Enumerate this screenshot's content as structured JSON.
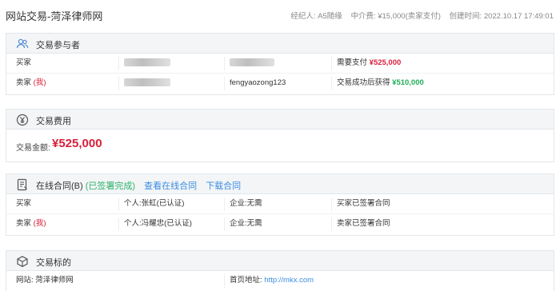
{
  "header": {
    "title": "网站交易-菏泽律师网",
    "broker": "经纪人: A5随缘",
    "fee": "中介费: ¥15,000(卖家支付)",
    "created": "创建时间: 2022.10.17 17:49:01"
  },
  "participants": {
    "heading": "交易参与者",
    "buyer": {
      "label": "买家",
      "pay_label": "需要支付",
      "pay_amount": "¥525,000"
    },
    "seller": {
      "label": "卖家",
      "me_tag": "(我)",
      "username": "fengyaozong123",
      "gain_label": "交易成功后获得",
      "gain_amount": "¥510,000"
    }
  },
  "fee_section": {
    "heading": "交易费用",
    "amount_label": "交易金额:",
    "amount": "¥525,000"
  },
  "contract": {
    "heading": "在线合同(B)",
    "status": "(已签署完成)",
    "view_link": "查看在线合同",
    "download_link": "下载合同",
    "rows": [
      {
        "role": "买家",
        "me_tag": "",
        "person": "个人:张虹(已认证)",
        "company": "企业:无需",
        "state": "买家已签署合同"
      },
      {
        "role": "卖家",
        "me_tag": "(我)",
        "person": "个人:冯耀忠(已认证)",
        "company": "企业:无需",
        "state": "卖家已签署合同"
      }
    ]
  },
  "target": {
    "heading": "交易标的",
    "site_label": "网站: 菏泽律师网",
    "home_label": "首页地址:",
    "home_url": "http://mkx.com"
  },
  "colors": {
    "accent": "#3b8de0",
    "price_red": "#d9203b",
    "success_green": "#1fae56"
  }
}
